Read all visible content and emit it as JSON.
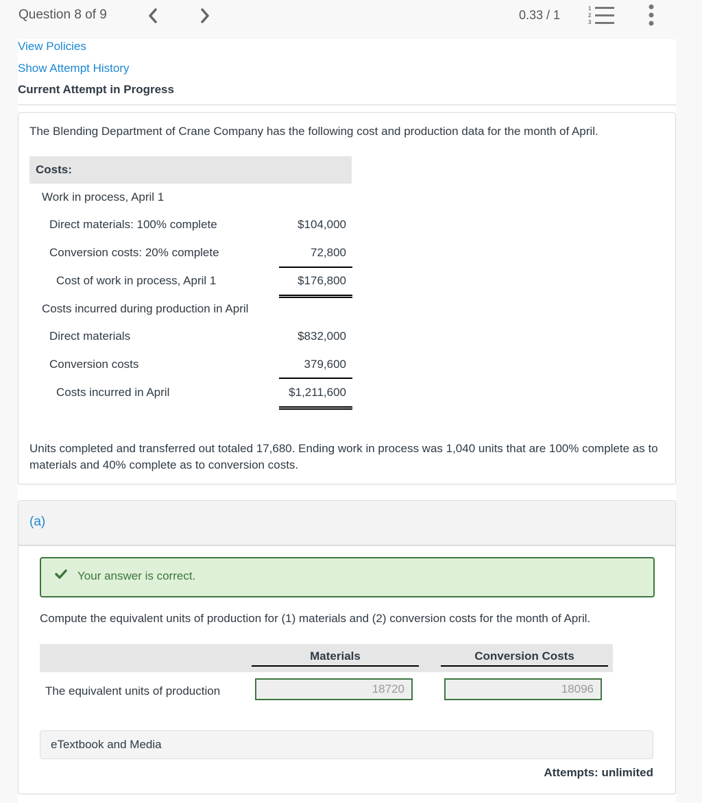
{
  "header": {
    "question_label": "Question 8 of 9",
    "score": "0.33 / 1",
    "prev_icon": "chevron-left-icon",
    "next_icon": "chevron-right-icon",
    "list_icon": "numbered-list-icon",
    "more_icon": "vertical-ellipsis-icon"
  },
  "links": {
    "view_policies": "View Policies",
    "show_attempt_history": "Show Attempt History"
  },
  "attempt_heading": "Current Attempt in Progress",
  "problem": {
    "intro": "The Blending Department of Crane Company has the following cost and production data for the month of April.",
    "costs_header": "Costs:",
    "rows": [
      {
        "label": "Work in process, April 1",
        "value": ""
      },
      {
        "label": "Direct materials: 100% complete",
        "value": "$104,000"
      },
      {
        "label": "Conversion costs: 20% complete",
        "value": "72,800"
      },
      {
        "label": "Cost of work in process, April 1",
        "value": "$176,800"
      },
      {
        "label": "Costs incurred during production in April",
        "value": ""
      },
      {
        "label": "Direct materials",
        "value": "$832,000"
      },
      {
        "label": "Conversion costs",
        "value": "379,600"
      },
      {
        "label": "Costs incurred in April",
        "value": "$1,211,600"
      }
    ],
    "units_text": "Units completed and transferred out totaled 17,680. Ending work in process was 1,040 units that are 100% complete as to materials and 40% complete as to conversion costs."
  },
  "part_a": {
    "label": "(a)",
    "feedback": "Your answer is correct.",
    "feedback_icon": "checkmark-icon",
    "prompt": "Compute the equivalent units of production for (1) materials and (2) conversion costs for the month of April.",
    "columns": [
      "Materials",
      "Conversion Costs"
    ],
    "row_label": "The equivalent units of production",
    "materials_value": "18720",
    "conversion_value": "18096",
    "etextbook": "eTextbook and Media",
    "attempts": "Attempts: unlimited"
  },
  "colors": {
    "link": "#1b87d3",
    "correct_border": "#3c763d",
    "correct_bg": "#dff0d8"
  }
}
